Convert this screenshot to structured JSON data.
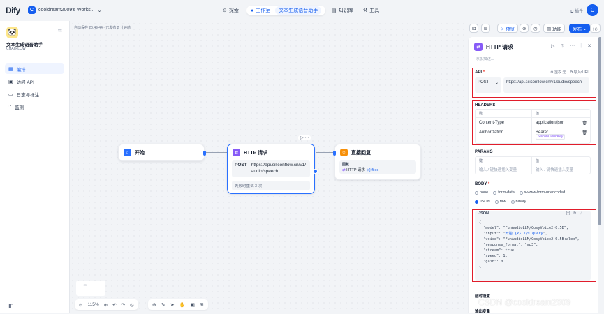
{
  "header": {
    "logo": "Dify",
    "workspace_badge": "C",
    "workspace": "cooldream2009's Works...",
    "nav": [
      {
        "icon": "compass-icon",
        "label": "探索"
      },
      {
        "icon": "studio-icon",
        "label": "工作室",
        "sub": "文本生成语音助手"
      },
      {
        "icon": "book-icon",
        "label": "知识库"
      },
      {
        "icon": "tool-icon",
        "label": "工具"
      }
    ],
    "notify": "插件",
    "avatar": "C"
  },
  "sidebar": {
    "app_name": "文本生成语音助手",
    "app_type": "CHATFLOW",
    "items": [
      {
        "label": "编排",
        "icon": "layout-icon",
        "active": true
      },
      {
        "label": "访问 API",
        "icon": "api-icon"
      },
      {
        "label": "日志与标注",
        "icon": "file-icon"
      },
      {
        "label": "监测",
        "icon": "monitor-icon"
      }
    ]
  },
  "canvas": {
    "autosave": "自动保存 20:49:44 · 已发布 2 分钟前",
    "start_node": {
      "title": "开始"
    },
    "http_node": {
      "title": "HTTP 请求",
      "method": "POST",
      "url": "https://api.siliconflow.cn/v1/audio/speech",
      "retry": "失败时重试 3 次"
    },
    "answer_node": {
      "title": "直接回复",
      "label": "回复",
      "content": "HTTP 请求",
      "var": "{x} files"
    },
    "zoom": "115%"
  },
  "top_right": {
    "preview": "预览",
    "features": "功能",
    "publish": "发布"
  },
  "panel": {
    "title": "HTTP 请求",
    "description_placeholder": "添加描述...",
    "api_label": "API",
    "auth": "鉴权 无",
    "import_curl": "导入cURL",
    "method": "POST",
    "url": "https://api.siliconflow.cn/v1/audio/speech",
    "headers_label": "HEADERS",
    "kv_key": "键",
    "kv_value": "值",
    "headers": [
      {
        "key": "Content-Type",
        "value": "application/json"
      },
      {
        "key": "Authorization",
        "value": "Bearer",
        "chip": "SiliconCloudKey"
      }
    ],
    "params_label": "PARAMS",
    "params_key_placeholder": "输入 / 键快速插入变量",
    "params_value_placeholder": "输入 / 键快速插入变量",
    "body_label": "BODY",
    "body_types": [
      "none",
      "form-data",
      "x-www-form-urlencoded",
      "JSON",
      "raw",
      "binary"
    ],
    "body_selected": "JSON",
    "json_label": "JSON",
    "json_lines": [
      "{",
      "  \"model\": \"FunAudioLLM/CosyVoice2-0.5B\",",
      "  \"input\": \"",
      "  \"voice\": \"FunAudioLLM/CosyVoice2-0.5B:alex\",",
      "  \"response_format\": \"mp3\",",
      "  \"stream\": true,",
      "  \"speed\": 1,",
      "  \"gain\": 0",
      "}"
    ],
    "json_var": "开始 {x} sys.query",
    "json_var_suffix": "\",",
    "timeout_label": "超时设置",
    "output_label": "输出变量"
  },
  "watermark": "CSDN @cooldream2009",
  "colors": {
    "accent": "#155eef",
    "highlight": "#e11d2b"
  }
}
